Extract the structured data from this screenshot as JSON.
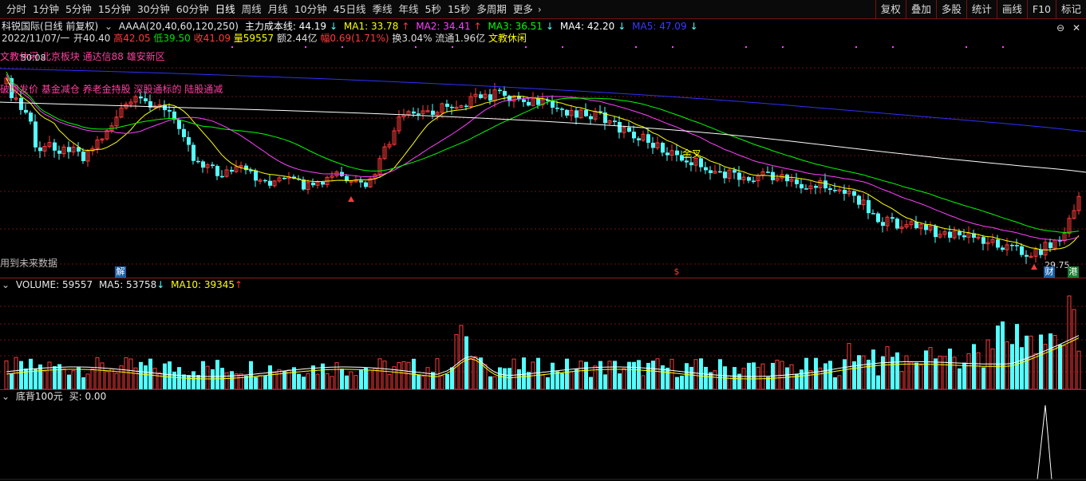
{
  "period_tabs": [
    "分时",
    "1分钟",
    "5分钟",
    "15分钟",
    "30分钟",
    "60分钟",
    "日线",
    "周线",
    "月线",
    "10分钟",
    "45日线",
    "季线",
    "年线",
    "5秒",
    "15秒",
    "多周期",
    "更多"
  ],
  "active_tab": "日线",
  "toolbar": [
    "复权",
    "叠加",
    "多股",
    "统计",
    "画线",
    "F10",
    "标记"
  ],
  "window_controls": {
    "restore": "⊖",
    "close": "✕"
  },
  "info": {
    "stock": "科锐国际(日线 前复权)",
    "indicator_name": "AAAA(20,40,60,120,250)",
    "main_cost": "主力成本线: 44.19",
    "ma1": "MA1: 33.78",
    "ma2": "MA2: 34.41",
    "ma3": "MA3: 36.51",
    "ma4": "MA4: 42.20",
    "ma5": "MA5: 47.09",
    "date": "2022/11/07/一",
    "open": "开40.40",
    "high": "高42.05",
    "low": "低39.50",
    "close": "收41.09",
    "volume": "量59557",
    "amount": "额2.44亿",
    "change": "幅0.69(1.71%)",
    "turnover": "换3.04%",
    "float": "流通1.96亿",
    "sector": "文教休闲"
  },
  "overlays": {
    "line1": "文教休闲 北京板块 通达信88 雄安新区",
    "line2": "破增发价 基金减仓 养老金持股 深股通标的 陆股通减",
    "price_label": "50.08",
    "future_data": "用到未来数据",
    "golden_cross": "金叉",
    "low_price": "29.75",
    "badge_jie": "解",
    "badge_dollar": "$",
    "badge_cai": "财",
    "badge_gang": "港"
  },
  "volume_info": {
    "label": "VOLUME: 59557",
    "ma5": "MA5: 53758",
    "ma10": "MA10: 39345"
  },
  "bottom_info": {
    "label": "底背100元",
    "buy": "买: 0.00"
  },
  "colors": {
    "up": "#ff3a3a",
    "down": "#54ffff",
    "ma1": "#ffff00",
    "ma2": "#ff40ff",
    "ma3": "#00ff00",
    "ma4": "#ffffff",
    "ma5": "#3030ff",
    "pink": "#ff3f9f"
  }
}
